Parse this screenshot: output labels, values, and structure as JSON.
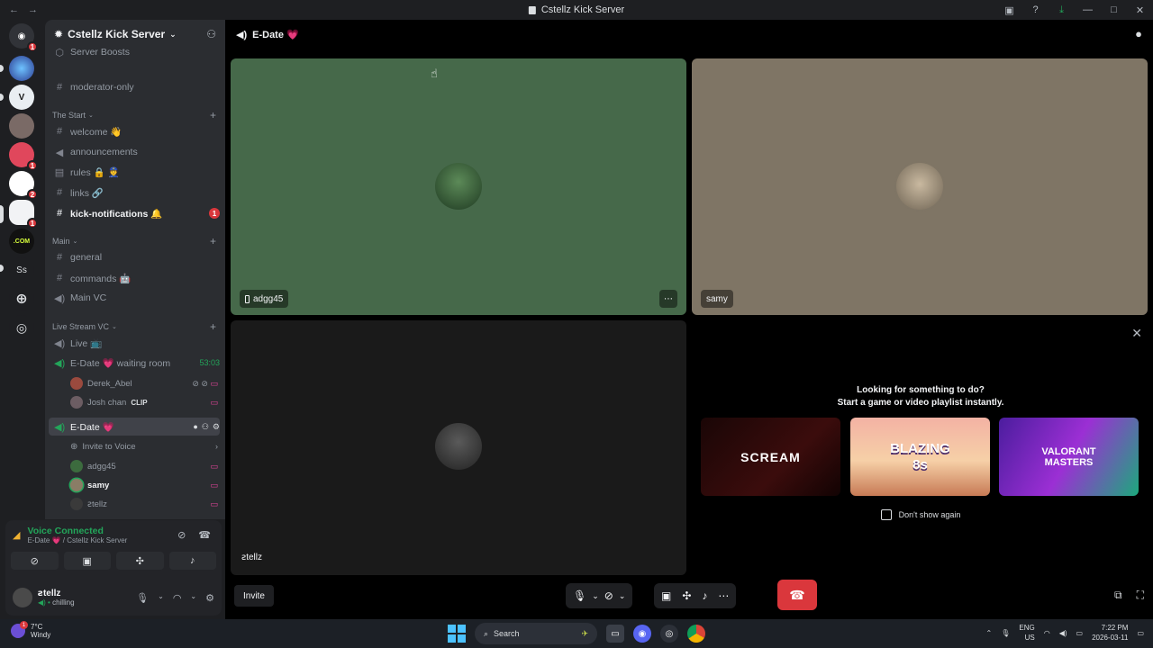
{
  "window": {
    "title": "Cstellz Kick Server",
    "back": "←",
    "forward": "→"
  },
  "server": {
    "name": "Cstellz Kick Server"
  },
  "sidebar": {
    "top_item": "Server Boosts",
    "moderator": "moderator-only",
    "categories": {
      "start": "The Start",
      "main": "Main",
      "live": "Live Stream VC"
    },
    "start_channels": [
      {
        "label": "welcome 👋"
      },
      {
        "label": "announcements"
      },
      {
        "label": "rules 🔒 👮"
      },
      {
        "label": "links 🔗"
      },
      {
        "label": "kick-notifications 🔔",
        "badge": "1"
      }
    ],
    "main_channels": [
      {
        "label": "general"
      },
      {
        "label": "commands 🤖"
      },
      {
        "label": "Main VC"
      }
    ],
    "live_channels": [
      {
        "label": "Live 📺"
      },
      {
        "label": "E-Date 💗 waiting room",
        "timer": "53:03"
      }
    ],
    "waiting_users": [
      {
        "name": "Derek_Abel"
      },
      {
        "name": "Josh chan",
        "tag": "CLIP"
      }
    ],
    "active_channel": "E-Date 💗",
    "invite_voice": "Invite to Voice",
    "voice_users": [
      {
        "name": "adgg45"
      },
      {
        "name": "samy"
      },
      {
        "name": "ꙅtellz"
      }
    ]
  },
  "voice_panel": {
    "status": "Voice Connected",
    "location": "E-Date 💗 / Cstellz Kick Server"
  },
  "user_panel": {
    "name": "ꙅtellz",
    "status": "chilling"
  },
  "channel_header": {
    "name": "E-Date 💗"
  },
  "tiles": [
    {
      "name": "adgg45"
    },
    {
      "name": "samy"
    },
    {
      "name": "ꙅtellz"
    }
  ],
  "activity": {
    "line1": "Looking for something to do?",
    "line2": "Start a game or video playlist instantly.",
    "cards": [
      "SCREAM",
      "BLAZING 8s",
      "VALORANT MASTERS"
    ],
    "dont_show": "Don't show again"
  },
  "controls": {
    "invite": "Invite"
  },
  "taskbar": {
    "temp": "7°C",
    "weather": "Windy",
    "search": "Search",
    "lang1": "ENG",
    "lang2": "US",
    "time": "7:22 PM",
    "date": "2026-03-11",
    "weather_badge": "1"
  },
  "rail": {
    "badge_home": "1",
    "badge_s4": "1",
    "badge_s6": "2",
    "badge_s7": "1",
    "ss": "Ss",
    "com": ".COM"
  },
  "colors": {
    "accent_green": "#23a55a",
    "danger": "#da373c",
    "mention": "#eb459e",
    "tile1": "#46694a",
    "tile2": "#7f7565",
    "tile3": "#1a1a1a"
  }
}
